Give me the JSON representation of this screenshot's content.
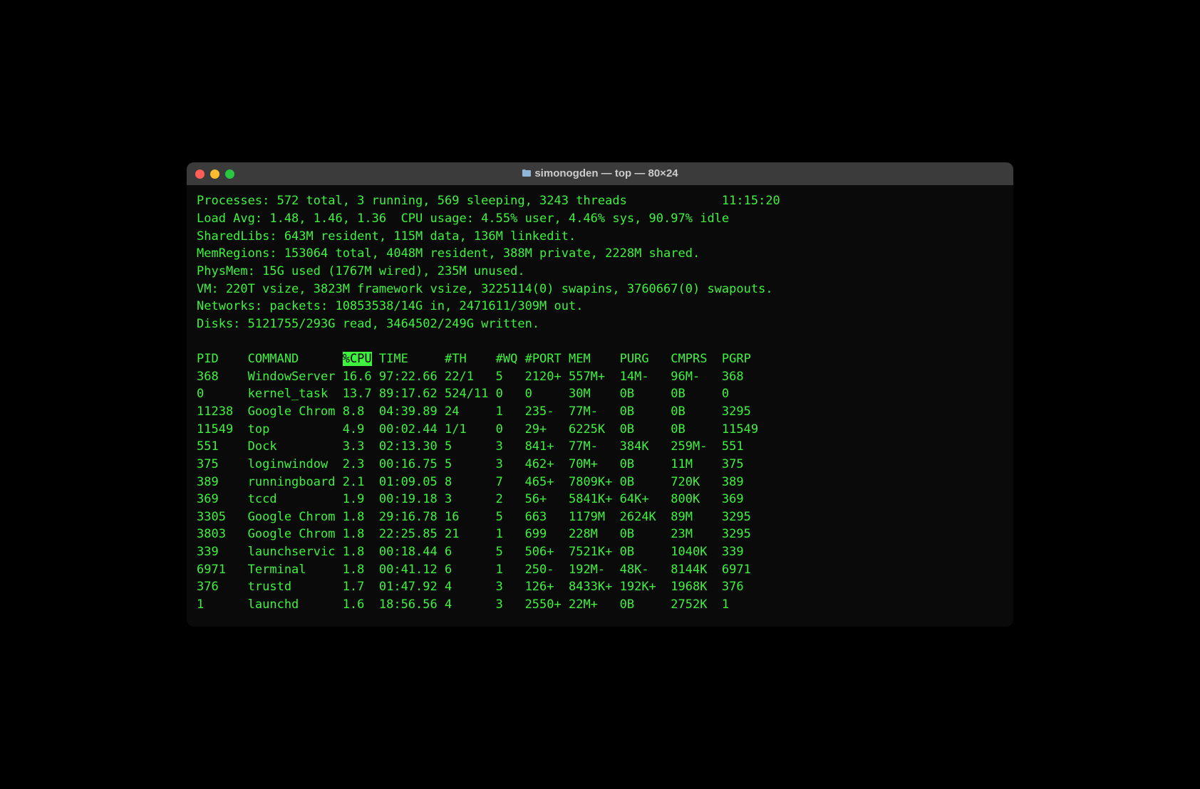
{
  "window": {
    "title": "simonogden — top — 80×24"
  },
  "summary": {
    "processes_line_left": "Processes: 572 total, 3 running, 569 sleeping, 3243 threads",
    "processes_line_right": "11:15:20",
    "load_line": "Load Avg: 1.48, 1.46, 1.36  CPU usage: 4.55% user, 4.46% sys, 90.97% idle",
    "sharedlibs_line": "SharedLibs: 643M resident, 115M data, 136M linkedit.",
    "memregions_line": "MemRegions: 153064 total, 4048M resident, 388M private, 2228M shared.",
    "physmem_line": "PhysMem: 15G used (1767M wired), 235M unused.",
    "vm_line": "VM: 220T vsize, 3823M framework vsize, 3225114(0) swapins, 3760667(0) swapouts.",
    "networks_line": "Networks: packets: 10853538/14G in, 2471611/309M out.",
    "disks_line": "Disks: 5121755/293G read, 3464502/249G written."
  },
  "columns": {
    "pid": "PID",
    "command": "COMMAND",
    "cpu": "%CPU",
    "time": "TIME",
    "th": "#TH",
    "wq": "#WQ",
    "port": "#PORT",
    "mem": "MEM",
    "purg": "PURG",
    "cmprs": "CMPRS",
    "pgrp": "PGRP"
  },
  "rows": [
    {
      "pid": "368",
      "command": "WindowServer",
      "cpu": "16.6",
      "time": "97:22.66",
      "th": "22/1",
      "wq": "5",
      "port": "2120+",
      "mem": "557M+",
      "purg": "14M-",
      "cmprs": "96M-",
      "pgrp": "368"
    },
    {
      "pid": "0",
      "command": "kernel_task",
      "cpu": "13.7",
      "time": "89:17.62",
      "th": "524/11",
      "wq": "0",
      "port": "0",
      "mem": "30M",
      "purg": "0B",
      "cmprs": "0B",
      "pgrp": "0"
    },
    {
      "pid": "11238",
      "command": "Google Chrom",
      "cpu": "8.8",
      "time": "04:39.89",
      "th": "24",
      "wq": "1",
      "port": "235-",
      "mem": "77M-",
      "purg": "0B",
      "cmprs": "0B",
      "pgrp": "3295"
    },
    {
      "pid": "11549",
      "command": "top",
      "cpu": "4.9",
      "time": "00:02.44",
      "th": "1/1",
      "wq": "0",
      "port": "29+",
      "mem": "6225K",
      "purg": "0B",
      "cmprs": "0B",
      "pgrp": "11549"
    },
    {
      "pid": "551",
      "command": "Dock",
      "cpu": "3.3",
      "time": "02:13.30",
      "th": "5",
      "wq": "3",
      "port": "841+",
      "mem": "77M-",
      "purg": "384K",
      "cmprs": "259M-",
      "pgrp": "551"
    },
    {
      "pid": "375",
      "command": "loginwindow",
      "cpu": "2.3",
      "time": "00:16.75",
      "th": "5",
      "wq": "3",
      "port": "462+",
      "mem": "70M+",
      "purg": "0B",
      "cmprs": "11M",
      "pgrp": "375"
    },
    {
      "pid": "389",
      "command": "runningboard",
      "cpu": "2.1",
      "time": "01:09.05",
      "th": "8",
      "wq": "7",
      "port": "465+",
      "mem": "7809K+",
      "purg": "0B",
      "cmprs": "720K",
      "pgrp": "389"
    },
    {
      "pid": "369",
      "command": "tccd",
      "cpu": "1.9",
      "time": "00:19.18",
      "th": "3",
      "wq": "2",
      "port": "56+",
      "mem": "5841K+",
      "purg": "64K+",
      "cmprs": "800K",
      "pgrp": "369"
    },
    {
      "pid": "3305",
      "command": "Google Chrom",
      "cpu": "1.8",
      "time": "29:16.78",
      "th": "16",
      "wq": "5",
      "port": "663",
      "mem": "1179M",
      "purg": "2624K",
      "cmprs": "89M",
      "pgrp": "3295"
    },
    {
      "pid": "3803",
      "command": "Google Chrom",
      "cpu": "1.8",
      "time": "22:25.85",
      "th": "21",
      "wq": "1",
      "port": "699",
      "mem": "228M",
      "purg": "0B",
      "cmprs": "23M",
      "pgrp": "3295"
    },
    {
      "pid": "339",
      "command": "launchservic",
      "cpu": "1.8",
      "time": "00:18.44",
      "th": "6",
      "wq": "5",
      "port": "506+",
      "mem": "7521K+",
      "purg": "0B",
      "cmprs": "1040K",
      "pgrp": "339"
    },
    {
      "pid": "6971",
      "command": "Terminal",
      "cpu": "1.8",
      "time": "00:41.12",
      "th": "6",
      "wq": "1",
      "port": "250-",
      "mem": "192M-",
      "purg": "48K-",
      "cmprs": "8144K",
      "pgrp": "6971"
    },
    {
      "pid": "376",
      "command": "trustd",
      "cpu": "1.7",
      "time": "01:47.92",
      "th": "4",
      "wq": "3",
      "port": "126+",
      "mem": "8433K+",
      "purg": "192K+",
      "cmprs": "1968K",
      "pgrp": "376"
    },
    {
      "pid": "1",
      "command": "launchd",
      "cpu": "1.6",
      "time": "18:56.56",
      "th": "4",
      "wq": "3",
      "port": "2550+",
      "mem": "22M+",
      "purg": "0B",
      "cmprs": "2752K",
      "pgrp": "1"
    }
  ],
  "chart_data": {
    "type": "table",
    "title": "top",
    "columns": [
      "PID",
      "COMMAND",
      "%CPU",
      "TIME",
      "#TH",
      "#WQ",
      "#PORT",
      "MEM",
      "PURG",
      "CMPRS",
      "PGRP"
    ],
    "rows": [
      [
        "368",
        "WindowServer",
        "16.6",
        "97:22.66",
        "22/1",
        "5",
        "2120+",
        "557M+",
        "14M-",
        "96M-",
        "368"
      ],
      [
        "0",
        "kernel_task",
        "13.7",
        "89:17.62",
        "524/11",
        "0",
        "0",
        "30M",
        "0B",
        "0B",
        "0"
      ],
      [
        "11238",
        "Google Chrom",
        "8.8",
        "04:39.89",
        "24",
        "1",
        "235-",
        "77M-",
        "0B",
        "0B",
        "3295"
      ],
      [
        "11549",
        "top",
        "4.9",
        "00:02.44",
        "1/1",
        "0",
        "29+",
        "6225K",
        "0B",
        "0B",
        "11549"
      ],
      [
        "551",
        "Dock",
        "3.3",
        "02:13.30",
        "5",
        "3",
        "841+",
        "77M-",
        "384K",
        "259M-",
        "551"
      ],
      [
        "375",
        "loginwindow",
        "2.3",
        "00:16.75",
        "5",
        "3",
        "462+",
        "70M+",
        "0B",
        "11M",
        "375"
      ],
      [
        "389",
        "runningboard",
        "2.1",
        "01:09.05",
        "8",
        "7",
        "465+",
        "7809K+",
        "0B",
        "720K",
        "389"
      ],
      [
        "369",
        "tccd",
        "1.9",
        "00:19.18",
        "3",
        "2",
        "56+",
        "5841K+",
        "64K+",
        "800K",
        "369"
      ],
      [
        "3305",
        "Google Chrom",
        "1.8",
        "29:16.78",
        "16",
        "5",
        "663",
        "1179M",
        "2624K",
        "89M",
        "3295"
      ],
      [
        "3803",
        "Google Chrom",
        "1.8",
        "22:25.85",
        "21",
        "1",
        "699",
        "228M",
        "0B",
        "23M",
        "3295"
      ],
      [
        "339",
        "launchservic",
        "1.8",
        "00:18.44",
        "6",
        "5",
        "506+",
        "7521K+",
        "0B",
        "1040K",
        "339"
      ],
      [
        "6971",
        "Terminal",
        "1.8",
        "00:41.12",
        "6",
        "1",
        "250-",
        "192M-",
        "48K-",
        "8144K",
        "6971"
      ],
      [
        "376",
        "trustd",
        "1.7",
        "01:47.92",
        "4",
        "3",
        "126+",
        "8433K+",
        "192K+",
        "1968K",
        "376"
      ],
      [
        "1",
        "launchd",
        "1.6",
        "18:56.56",
        "4",
        "3",
        "2550+",
        "22M+",
        "0B",
        "2752K",
        "1"
      ]
    ]
  }
}
